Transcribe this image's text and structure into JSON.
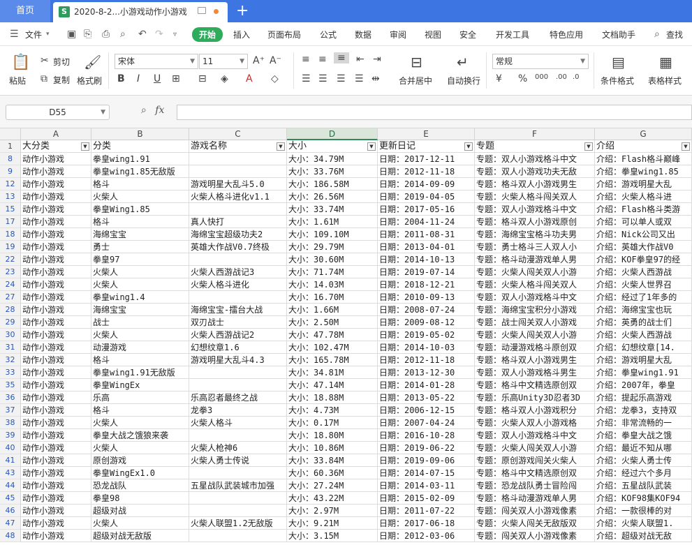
{
  "tabs": {
    "home": "首页",
    "doc_title": "2020-8-2...小游戏动作小游戏",
    "doc_icon": "S",
    "new_tab": "+"
  },
  "menu": {
    "file": "文件",
    "items": [
      "开始",
      "插入",
      "页面布局",
      "公式",
      "数据",
      "审阅",
      "视图",
      "安全",
      "开发工具",
      "特色应用",
      "文档助手"
    ],
    "search": "查找"
  },
  "ribbon": {
    "paste": "粘贴",
    "cut": "剪切",
    "copy": "复制",
    "format_painter": "格式刷",
    "font_name": "宋体",
    "font_size": "11",
    "merge_center": "合并居中",
    "wrap_text": "自动换行",
    "number_format": "常规",
    "conditional_format": "条件格式",
    "table_style": "表格样式"
  },
  "formula_bar": {
    "name_box": "D55",
    "fx": "fx",
    "value": ""
  },
  "grid": {
    "columns": [
      {
        "letter": "A",
        "selected": false
      },
      {
        "letter": "B",
        "selected": false
      },
      {
        "letter": "C",
        "selected": false
      },
      {
        "letter": "D",
        "selected": true
      },
      {
        "letter": "E",
        "selected": false
      },
      {
        "letter": "F",
        "selected": false
      },
      {
        "letter": "G",
        "selected": false
      }
    ],
    "header_row": {
      "num": "1",
      "cells": [
        "大分类",
        "分类",
        "游戏名称",
        "大小",
        "更新日记",
        "专题",
        "介绍"
      ]
    },
    "rows": [
      {
        "num": "8",
        "cells": [
          "动作小游戏",
          "拳皇wing1.91",
          "",
          "大小：34.79M",
          "日期：2017-12-11",
          "专题：双人小游戏格斗中文",
          "介绍：Flash格斗巅峰"
        ]
      },
      {
        "num": "9",
        "cells": [
          "动作小游戏",
          "拳皇wing1.85无敌版",
          "",
          "大小：33.76M",
          "日期：2012-11-18",
          "专题：双人小游戏功夫无敌",
          "介绍：拳皇wing1.85"
        ]
      },
      {
        "num": "12",
        "cells": [
          "动作小游戏",
          "格斗",
          "游戏明星大乱斗5.0",
          "大小：186.58M",
          "日期：2014-09-09",
          "专题：格斗双人小游戏男生",
          "介绍：游戏明星大乱"
        ]
      },
      {
        "num": "13",
        "cells": [
          "动作小游戏",
          "火柴人",
          "火柴人格斗进化v1.1",
          "大小：26.56M",
          "日期：2019-04-05",
          "专题：火柴人格斗闯关双人",
          "介绍：火柴人格斗进"
        ]
      },
      {
        "num": "15",
        "cells": [
          "动作小游戏",
          "拳皇Wing1.85",
          "",
          "大小：33.74M",
          "日期：2017-05-16",
          "专题：双人小游戏格斗中文",
          "介绍：Flash格斗类游"
        ]
      },
      {
        "num": "17",
        "cells": [
          "动作小游戏",
          "格斗",
          "真人快打",
          "大小：1.61M",
          "日期：2004-11-24",
          "专题：格斗双人小游戏原创",
          "介绍：可以单人或双"
        ]
      },
      {
        "num": "18",
        "cells": [
          "动作小游戏",
          "海绵宝宝",
          "海绵宝宝超级功夫2",
          "大小：109.10M",
          "日期：2011-08-31",
          "专题：海绵宝宝格斗功夫男",
          "介绍：Nick公司又出"
        ]
      },
      {
        "num": "19",
        "cells": [
          "动作小游戏",
          "勇士",
          "英雄大作战V0.7终极",
          "大小：29.79M",
          "日期：2013-04-01",
          "专题：勇士格斗三人双人小",
          "介绍：英雄大作战V0"
        ]
      },
      {
        "num": "22",
        "cells": [
          "动作小游戏",
          "拳皇97",
          "",
          "大小：30.60M",
          "日期：2014-10-13",
          "专题：格斗动漫游戏单人男",
          "介绍：KOF拳皇97的经"
        ]
      },
      {
        "num": "23",
        "cells": [
          "动作小游戏",
          "火柴人",
          "火柴人西游战记3",
          "大小：71.74M",
          "日期：2019-07-14",
          "专题：火柴人闯关双人小游",
          "介绍：火柴人西游战"
        ]
      },
      {
        "num": "24",
        "cells": [
          "动作小游戏",
          "火柴人",
          "火柴人格斗进化",
          "大小：14.03M",
          "日期：2018-12-21",
          "专题：火柴人格斗闯关双人",
          "介绍：火柴人世界召"
        ]
      },
      {
        "num": "27",
        "cells": [
          "动作小游戏",
          "拳皇wing1.4",
          "",
          "大小：16.70M",
          "日期：2010-09-13",
          "专题：双人小游戏格斗中文",
          "介绍：经过了1年多的"
        ]
      },
      {
        "num": "28",
        "cells": [
          "动作小游戏",
          "海绵宝宝",
          "海绵宝宝-擂台大战",
          "大小：1.66M",
          "日期：2008-07-24",
          "专题：海绵宝宝积分小游戏",
          "介绍：海绵宝宝也玩"
        ]
      },
      {
        "num": "29",
        "cells": [
          "动作小游戏",
          "战士",
          "双刃战士",
          "大小：2.50M",
          "日期：2009-08-12",
          "专题：战士闯关双人小游戏",
          "介绍：英勇的战士们"
        ]
      },
      {
        "num": "30",
        "cells": [
          "动作小游戏",
          "火柴人",
          "火柴人西游战记2",
          "大小：47.78M",
          "日期：2019-05-02",
          "专题：火柴人闯关双人小游",
          "介绍：火柴人西游战"
        ]
      },
      {
        "num": "31",
        "cells": [
          "动作小游戏",
          "动漫游戏",
          "幻想纹章1.6",
          "大小：102.47M",
          "日期：2014-10-03",
          "专题：动漫游戏格斗原创双",
          "介绍：幻想纹章[14."
        ]
      },
      {
        "num": "32",
        "cells": [
          "动作小游戏",
          "格斗",
          "游戏明星大乱斗4.3",
          "大小：165.78M",
          "日期：2012-11-18",
          "专题：格斗双人小游戏男生",
          "介绍：游戏明星大乱"
        ]
      },
      {
        "num": "33",
        "cells": [
          "动作小游戏",
          "拳皇wing1.91无敌版",
          "",
          "大小：34.81M",
          "日期：2013-12-30",
          "专题：双人小游戏格斗男生",
          "介绍：拳皇wing1.91"
        ]
      },
      {
        "num": "35",
        "cells": [
          "动作小游戏",
          "拳皇WingEx",
          "",
          "大小：47.14M",
          "日期：2014-01-28",
          "专题：格斗中文精选原创双",
          "介绍：2007年，拳皇"
        ]
      },
      {
        "num": "36",
        "cells": [
          "动作小游戏",
          "乐高",
          "乐高忍者最终之战",
          "大小：18.88M",
          "日期：2013-05-22",
          "专题：乐高Unity3D忍者3D",
          "介绍：提起乐高游戏"
        ]
      },
      {
        "num": "37",
        "cells": [
          "动作小游戏",
          "格斗",
          "龙拳3",
          "大小：4.73M",
          "日期：2006-12-15",
          "专题：格斗双人小游戏积分",
          "介绍：龙拳3，支持双"
        ]
      },
      {
        "num": "38",
        "cells": [
          "动作小游戏",
          "火柴人",
          "火柴人格斗",
          "大小：0.17M",
          "日期：2007-04-24",
          "专题：火柴人双人小游戏格",
          "介绍：非常流畅的一"
        ]
      },
      {
        "num": "39",
        "cells": [
          "动作小游戏",
          "拳皇大战之饿狼来袭",
          "",
          "大小：18.80M",
          "日期：2016-10-28",
          "专题：双人小游戏格斗中文",
          "介绍：拳皇大战之饿"
        ]
      },
      {
        "num": "40",
        "cells": [
          "动作小游戏",
          "火柴人",
          "火柴人枪神6",
          "大小：10.86M",
          "日期：2019-06-22",
          "专题：火柴人闯关双人小游",
          "介绍：最近不知从哪"
        ]
      },
      {
        "num": "41",
        "cells": [
          "动作小游戏",
          "原创游戏",
          "火柴人勇士传说",
          "大小：33.84M",
          "日期：2019-09-06",
          "专题：原创游戏闯关火柴人",
          "介绍：火柴人勇士传"
        ]
      },
      {
        "num": "43",
        "cells": [
          "动作小游戏",
          "拳皇WingEx1.0",
          "",
          "大小：60.36M",
          "日期：2014-07-15",
          "专题：格斗中文精选原创双",
          "介绍：经过六个多月"
        ]
      },
      {
        "num": "44",
        "cells": [
          "动作小游戏",
          "恐龙战队",
          "五星战队武装城市加强",
          "大小：27.24M",
          "日期：2014-03-11",
          "专题：恐龙战队勇士冒险闯",
          "介绍：五星战队武装"
        ]
      },
      {
        "num": "45",
        "cells": [
          "动作小游戏",
          "拳皇98",
          "",
          "大小：43.22M",
          "日期：2015-02-09",
          "专题：格斗动漫游戏单人男",
          "介绍：KOF98集KOF94"
        ]
      },
      {
        "num": "46",
        "cells": [
          "动作小游戏",
          "超级对战",
          "",
          "大小：2.97M",
          "日期：2011-07-22",
          "专题：闯关双人小游戏像素",
          "介绍：一款很棒的对"
        ]
      },
      {
        "num": "47",
        "cells": [
          "动作小游戏",
          "火柴人",
          "火柴人联盟1.2无敌版",
          "大小：9.21M",
          "日期：2017-06-18",
          "专题：火柴人闯关无敌版双",
          "介绍：火柴人联盟1."
        ]
      },
      {
        "num": "48",
        "cells": [
          "动作小游戏",
          "超级对战无敌版",
          "",
          "大小：3.15M",
          "日期：2012-03-06",
          "专题：闯关双人小游戏像素",
          "介绍：超级对战无敌"
        ]
      }
    ]
  }
}
